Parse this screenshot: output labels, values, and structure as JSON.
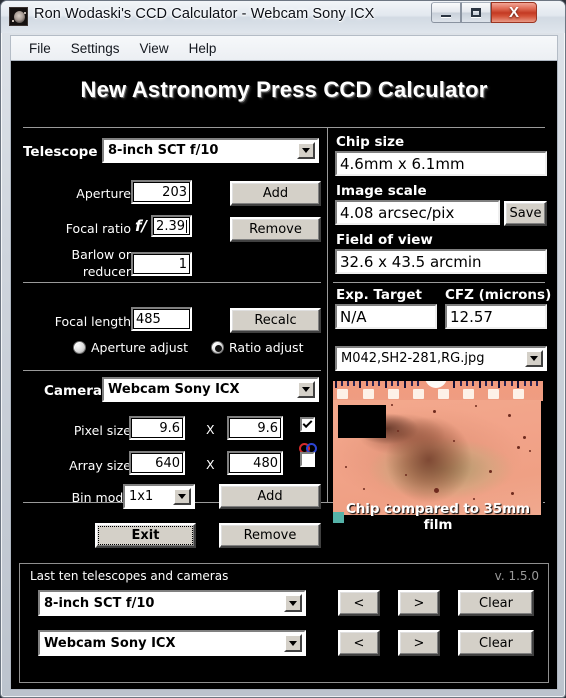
{
  "window": {
    "title": "Ron Wodaski's CCD Calculator - Webcam Sony ICX",
    "icon": "nebula-icon",
    "minimize_label": "",
    "maximize_label": "",
    "close_label": "X"
  },
  "menu": {
    "items": [
      {
        "label": "File"
      },
      {
        "label": "Settings"
      },
      {
        "label": "View"
      },
      {
        "label": "Help"
      }
    ]
  },
  "banner": {
    "title": "New Astronomy Press CCD Calculator"
  },
  "telescope": {
    "section_label": "Telescope",
    "selected": "8-inch SCT f/10",
    "aperture_label": "Aperture",
    "aperture_value": "203",
    "focal_ratio_label": "Focal ratio",
    "focal_ratio_prefix": "f/",
    "focal_ratio_value": "2.39",
    "barlow_label_line1": "Barlow or",
    "barlow_label_line2": "reducer",
    "barlow_value": "1",
    "add_label": "Add",
    "remove_label": "Remove"
  },
  "focal": {
    "focal_length_label": "Focal length",
    "focal_length_value": "485",
    "recalc_label": "Recalc",
    "aperture_adjust_label": "Aperture adjust",
    "ratio_adjust_label": "Ratio adjust",
    "selected_mode": "Ratio adjust"
  },
  "camera": {
    "section_label": "Camera",
    "selected": "Webcam Sony ICX",
    "pixel_size_label": "Pixel size",
    "pixel_size_x": "9.6",
    "pixel_size_y": "9.6",
    "array_size_label": "Array size",
    "array_size_x": "640",
    "array_size_y": "480",
    "multiply_symbol": "X",
    "bin_mode_label": "Bin mode",
    "bin_mode_value": "1x1",
    "add_label": "Add",
    "remove_label": "Remove",
    "exit_label": "Exit",
    "lock_pixel_checked": true,
    "lock_array_checked": false,
    "link_icon": "linked-rings-icon"
  },
  "results": {
    "chip_size_label": "Chip size",
    "chip_size_value": "4.6mm x 6.1mm",
    "image_scale_label": "Image scale",
    "image_scale_value": "4.08 arcsec/pix",
    "save_label": "Save",
    "field_of_view_label": "Field of view",
    "field_of_view_value": "32.6 x 43.5 arcmin",
    "exp_target_label": "Exp. Target",
    "exp_target_value": "N/A",
    "cfz_label": "CFZ  (microns)",
    "cfz_value": "12.57",
    "image_file_selected": "M042,SH2-281,RG.jpg"
  },
  "preview": {
    "caption": "Chip compared to 35mm film"
  },
  "bottom": {
    "last_label": "Last ten telescopes and cameras",
    "version": "v. 1.5.0",
    "telescope_history": "8-inch SCT f/10",
    "camera_history": "Webcam Sony ICX",
    "prev_label": "<",
    "next_label": ">",
    "clear_label": "Clear"
  }
}
